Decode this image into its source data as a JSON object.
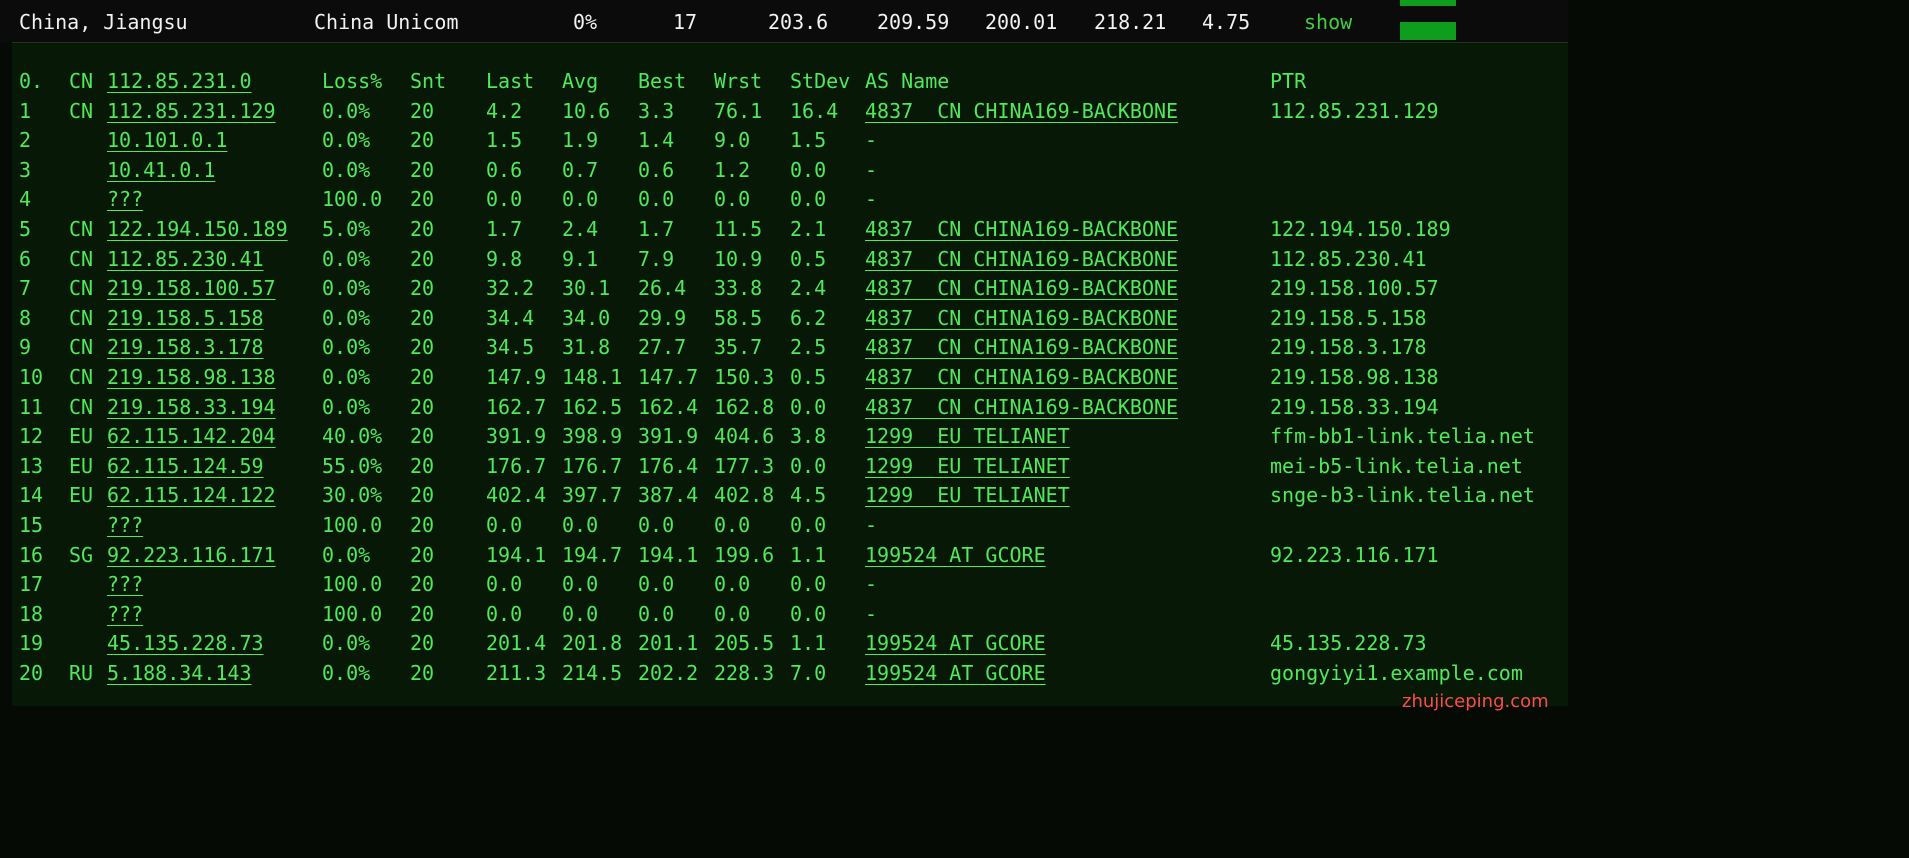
{
  "summary": {
    "location": "China, Jiangsu",
    "isp": "China Unicom",
    "loss": "0%",
    "sent": "17",
    "last": "203.6",
    "avg": "209.59",
    "best": "200.01",
    "worst": "218.21",
    "stdev": "4.75",
    "action": "show"
  },
  "table": {
    "header": {
      "hop": "0.",
      "cc": "CN",
      "host": "112.85.231.0",
      "loss": "Loss%",
      "snt": "Snt",
      "last": "Last",
      "avg": "Avg",
      "best": "Best",
      "wrst": "Wrst",
      "stdev": "StDev",
      "as": "AS Name",
      "ptr": "PTR"
    },
    "rows": [
      {
        "hop": "1",
        "cc": "CN",
        "host": "112.85.231.129",
        "loss": "0.0%",
        "snt": "20",
        "last": "4.2",
        "avg": "10.6",
        "best": "3.3",
        "wrst": "76.1",
        "stdev": "16.4",
        "as": "4837  CN CHINA169-BACKBONE",
        "ptr": "112.85.231.129"
      },
      {
        "hop": "2",
        "cc": "",
        "host": "10.101.0.1",
        "loss": "0.0%",
        "snt": "20",
        "last": "1.5",
        "avg": "1.9",
        "best": "1.4",
        "wrst": "9.0",
        "stdev": "1.5",
        "as": "-",
        "ptr": ""
      },
      {
        "hop": "3",
        "cc": "",
        "host": "10.41.0.1",
        "loss": "0.0%",
        "snt": "20",
        "last": "0.6",
        "avg": "0.7",
        "best": "0.6",
        "wrst": "1.2",
        "stdev": "0.0",
        "as": "-",
        "ptr": ""
      },
      {
        "hop": "4",
        "cc": "",
        "host": "???",
        "loss": "100.0",
        "snt": "20",
        "last": "0.0",
        "avg": "0.0",
        "best": "0.0",
        "wrst": "0.0",
        "stdev": "0.0",
        "as": "-",
        "ptr": ""
      },
      {
        "hop": "5",
        "cc": "CN",
        "host": "122.194.150.189",
        "loss": "5.0%",
        "snt": "20",
        "last": "1.7",
        "avg": "2.4",
        "best": "1.7",
        "wrst": "11.5",
        "stdev": "2.1",
        "as": "4837  CN CHINA169-BACKBONE",
        "ptr": "122.194.150.189"
      },
      {
        "hop": "6",
        "cc": "CN",
        "host": "112.85.230.41",
        "loss": "0.0%",
        "snt": "20",
        "last": "9.8",
        "avg": "9.1",
        "best": "7.9",
        "wrst": "10.9",
        "stdev": "0.5",
        "as": "4837  CN CHINA169-BACKBONE",
        "ptr": "112.85.230.41"
      },
      {
        "hop": "7",
        "cc": "CN",
        "host": "219.158.100.57",
        "loss": "0.0%",
        "snt": "20",
        "last": "32.2",
        "avg": "30.1",
        "best": "26.4",
        "wrst": "33.8",
        "stdev": "2.4",
        "as": "4837  CN CHINA169-BACKBONE",
        "ptr": "219.158.100.57"
      },
      {
        "hop": "8",
        "cc": "CN",
        "host": "219.158.5.158",
        "loss": "0.0%",
        "snt": "20",
        "last": "34.4",
        "avg": "34.0",
        "best": "29.9",
        "wrst": "58.5",
        "stdev": "6.2",
        "as": "4837  CN CHINA169-BACKBONE",
        "ptr": "219.158.5.158"
      },
      {
        "hop": "9",
        "cc": "CN",
        "host": "219.158.3.178",
        "loss": "0.0%",
        "snt": "20",
        "last": "34.5",
        "avg": "31.8",
        "best": "27.7",
        "wrst": "35.7",
        "stdev": "2.5",
        "as": "4837  CN CHINA169-BACKBONE",
        "ptr": "219.158.3.178"
      },
      {
        "hop": "10",
        "cc": "CN",
        "host": "219.158.98.138",
        "loss": "0.0%",
        "snt": "20",
        "last": "147.9",
        "avg": "148.1",
        "best": "147.7",
        "wrst": "150.3",
        "stdev": "0.5",
        "as": "4837  CN CHINA169-BACKBONE",
        "ptr": "219.158.98.138"
      },
      {
        "hop": "11",
        "cc": "CN",
        "host": "219.158.33.194",
        "loss": "0.0%",
        "snt": "20",
        "last": "162.7",
        "avg": "162.5",
        "best": "162.4",
        "wrst": "162.8",
        "stdev": "0.0",
        "as": "4837  CN CHINA169-BACKBONE",
        "ptr": "219.158.33.194"
      },
      {
        "hop": "12",
        "cc": "EU",
        "host": "62.115.142.204",
        "loss": "40.0%",
        "snt": "20",
        "last": "391.9",
        "avg": "398.9",
        "best": "391.9",
        "wrst": "404.6",
        "stdev": "3.8",
        "as": "1299  EU TELIANET",
        "ptr": "ffm-bb1-link.telia.net"
      },
      {
        "hop": "13",
        "cc": "EU",
        "host": "62.115.124.59",
        "loss": "55.0%",
        "snt": "20",
        "last": "176.7",
        "avg": "176.7",
        "best": "176.4",
        "wrst": "177.3",
        "stdev": "0.0",
        "as": "1299  EU TELIANET",
        "ptr": "mei-b5-link.telia.net"
      },
      {
        "hop": "14",
        "cc": "EU",
        "host": "62.115.124.122",
        "loss": "30.0%",
        "snt": "20",
        "last": "402.4",
        "avg": "397.7",
        "best": "387.4",
        "wrst": "402.8",
        "stdev": "4.5",
        "as": "1299  EU TELIANET",
        "ptr": "snge-b3-link.telia.net"
      },
      {
        "hop": "15",
        "cc": "",
        "host": "???",
        "loss": "100.0",
        "snt": "20",
        "last": "0.0",
        "avg": "0.0",
        "best": "0.0",
        "wrst": "0.0",
        "stdev": "0.0",
        "as": "-",
        "ptr": ""
      },
      {
        "hop": "16",
        "cc": "SG",
        "host": "92.223.116.171",
        "loss": "0.0%",
        "snt": "20",
        "last": "194.1",
        "avg": "194.7",
        "best": "194.1",
        "wrst": "199.6",
        "stdev": "1.1",
        "as": "199524 AT GCORE",
        "ptr": "92.223.116.171"
      },
      {
        "hop": "17",
        "cc": "",
        "host": "???",
        "loss": "100.0",
        "snt": "20",
        "last": "0.0",
        "avg": "0.0",
        "best": "0.0",
        "wrst": "0.0",
        "stdev": "0.0",
        "as": "-",
        "ptr": ""
      },
      {
        "hop": "18",
        "cc": "",
        "host": "???",
        "loss": "100.0",
        "snt": "20",
        "last": "0.0",
        "avg": "0.0",
        "best": "0.0",
        "wrst": "0.0",
        "stdev": "0.0",
        "as": "-",
        "ptr": ""
      },
      {
        "hop": "19",
        "cc": "",
        "host": "45.135.228.73",
        "loss": "0.0%",
        "snt": "20",
        "last": "201.4",
        "avg": "201.8",
        "best": "201.1",
        "wrst": "205.5",
        "stdev": "1.1",
        "as": "199524 AT GCORE",
        "ptr": "45.135.228.73"
      },
      {
        "hop": "20",
        "cc": "RU",
        "host": "5.188.34.143",
        "loss": "0.0%",
        "snt": "20",
        "last": "211.3",
        "avg": "214.5",
        "best": "202.2",
        "wrst": "228.3",
        "stdev": "7.0",
        "as": "199524 AT GCORE",
        "ptr": "gongyiyi1.example.com"
      }
    ]
  },
  "watermark": "zhujiceping.com",
  "colors": {
    "text_green": "#51e85a",
    "panel_bg": "#071807",
    "bar_green": "#0f9d1d",
    "watermark_red": "#ff4a4a"
  }
}
